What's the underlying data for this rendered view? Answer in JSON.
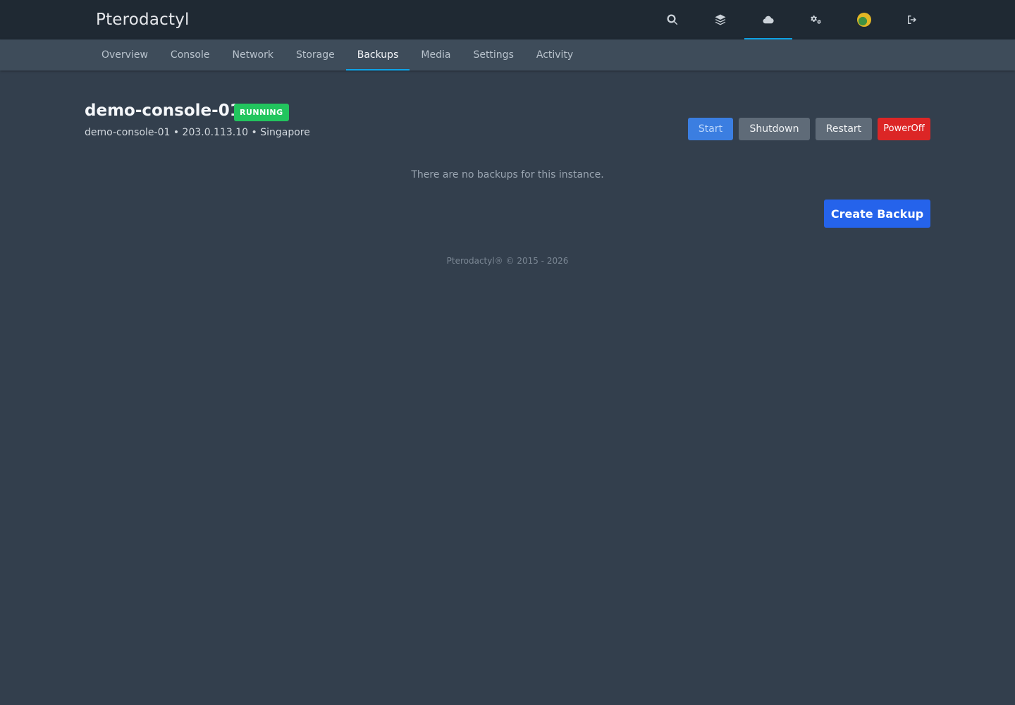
{
  "header": {
    "brand": "Pterodactyl",
    "nav": [
      {
        "icon": "search-icon",
        "active": false
      },
      {
        "icon": "layers-icon",
        "active": false
      },
      {
        "icon": "cloud-icon",
        "active": true
      },
      {
        "icon": "gears-icon",
        "active": false
      },
      {
        "icon": "avatar",
        "active": false
      },
      {
        "icon": "logout-icon",
        "active": false
      }
    ]
  },
  "tabs": [
    {
      "label": "Overview",
      "active": false
    },
    {
      "label": "Console",
      "active": false
    },
    {
      "label": "Network",
      "active": false
    },
    {
      "label": "Storage",
      "active": false
    },
    {
      "label": "Backups",
      "active": true
    },
    {
      "label": "Media",
      "active": false
    },
    {
      "label": "Settings",
      "active": false
    },
    {
      "label": "Activity",
      "active": false
    }
  ],
  "server": {
    "name": "demo-console-01",
    "status": "RUNNING",
    "meta": "demo-console-01 • 203.0.113.10 • Singapore"
  },
  "power": {
    "start": "Start",
    "shutdown": "Shutdown",
    "restart": "Restart",
    "poweroff_line1": "Power",
    "poweroff_line2": "Off"
  },
  "backups": {
    "empty_message": "There are no backups for this instance.",
    "create_label": "Create Backup"
  },
  "footer": {
    "text": "Pterodactyl® © 2015 - 2026"
  },
  "colors": {
    "accent": "#0ea5e9",
    "status_running": "#22c55e",
    "primary_button": "#2563eb",
    "danger_button": "#dc2626"
  }
}
